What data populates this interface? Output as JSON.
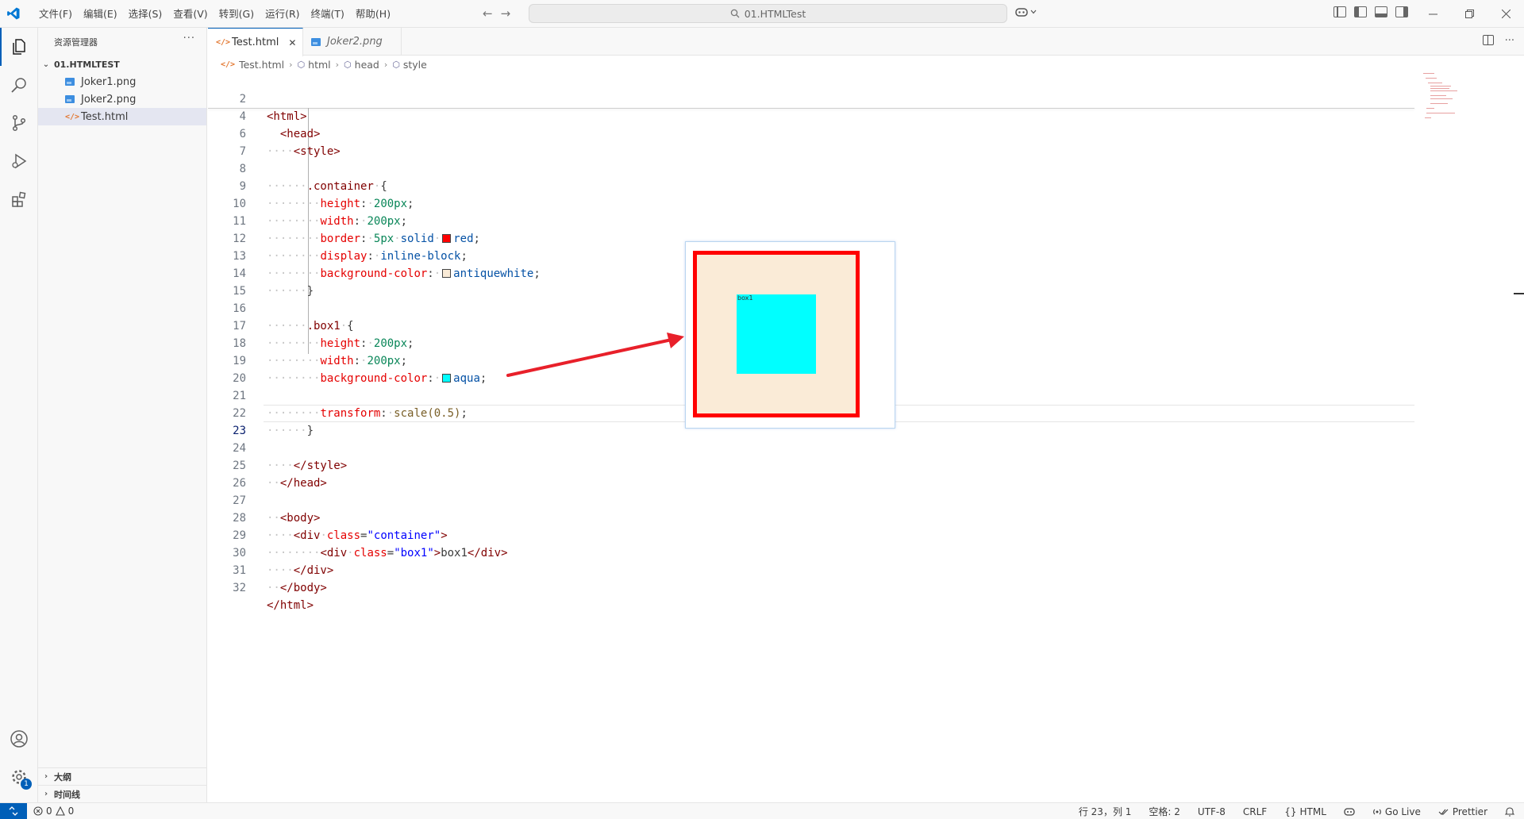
{
  "titlebar": {
    "menu": [
      "文件(F)",
      "编辑(E)",
      "选择(S)",
      "查看(V)",
      "转到(G)",
      "运行(R)",
      "终端(T)",
      "帮助(H)"
    ],
    "search_text": "01.HTMLTest",
    "back_glyph": "←",
    "forward_glyph": "→"
  },
  "sidebar": {
    "title": "资源管理器",
    "folder": "01.HTMLTEST",
    "files": [
      {
        "name": "Joker1.png",
        "icon": "image-file-icon"
      },
      {
        "name": "Joker2.png",
        "icon": "image-file-icon"
      },
      {
        "name": "Test.html",
        "icon": "html-file-icon",
        "selected": true
      }
    ],
    "sections": [
      "大纲",
      "时间线"
    ]
  },
  "activity": {
    "settings_badge": "1"
  },
  "tabs": [
    {
      "label": "Test.html",
      "active": true
    },
    {
      "label": "Joker2.png",
      "active": false
    }
  ],
  "breadcrumb": [
    "Test.html",
    "html",
    "head",
    "style"
  ],
  "editor": {
    "current_line": "23"
  },
  "preview": {
    "box_label": "box1",
    "colors": {
      "container_border": "#ff0000",
      "container_bg": "#faebd7",
      "box_bg": "#00ffff"
    }
  },
  "statusbar": {
    "errors": "0",
    "warnings": "0",
    "position": "行 23，列 1",
    "spaces": "空格: 2",
    "encoding": "UTF-8",
    "eol": "CRLF",
    "language": "HTML",
    "golive": "Go Live",
    "prettier": "Prettier"
  },
  "colors": {
    "accent": "#005fb8",
    "arrow": "#e8202a"
  }
}
